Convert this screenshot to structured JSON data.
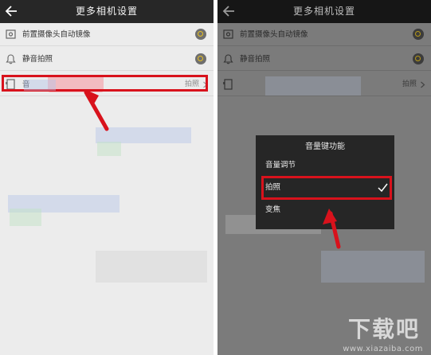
{
  "screen_title": "更多相机设置",
  "settings": [
    {
      "label": "前置摄像头自动镜像",
      "control": "toggle"
    },
    {
      "label": "静音拍照",
      "control": "toggle"
    },
    {
      "label": "音",
      "value": "拍照"
    }
  ],
  "dialog": {
    "title": "音量键功能",
    "options": [
      {
        "label": "音量调节",
        "selected": false
      },
      {
        "label": "拍照",
        "selected": true
      },
      {
        "label": "变焦",
        "selected": false
      }
    ]
  },
  "watermark": {
    "logo_text": "下载吧",
    "url": "www.xiazaiba.com"
  },
  "colors": {
    "highlight": "#d8121c",
    "toggle_ring": "#e8c020",
    "titlebar": "#272727"
  }
}
